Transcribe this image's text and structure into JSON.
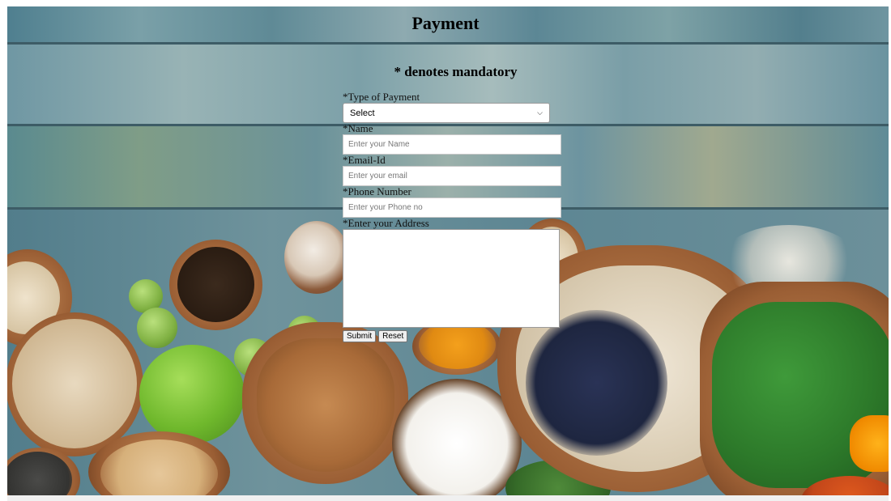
{
  "page": {
    "title": "Payment",
    "mandatory_note": "* denotes mandatory"
  },
  "form": {
    "payment_type": {
      "label": "*Type of Payment",
      "selected": "Select"
    },
    "name": {
      "label": "*Name",
      "placeholder": "Enter your Name"
    },
    "email": {
      "label": "*Email-Id",
      "placeholder": "Enter your email"
    },
    "phone": {
      "label": "*Phone Number",
      "placeholder": "Enter your Phone no"
    },
    "address": {
      "label": "*Enter your Address"
    },
    "submit_label": "Submit",
    "reset_label": "Reset"
  },
  "icons": {
    "select_chevron": "chevron-down-icon"
  }
}
